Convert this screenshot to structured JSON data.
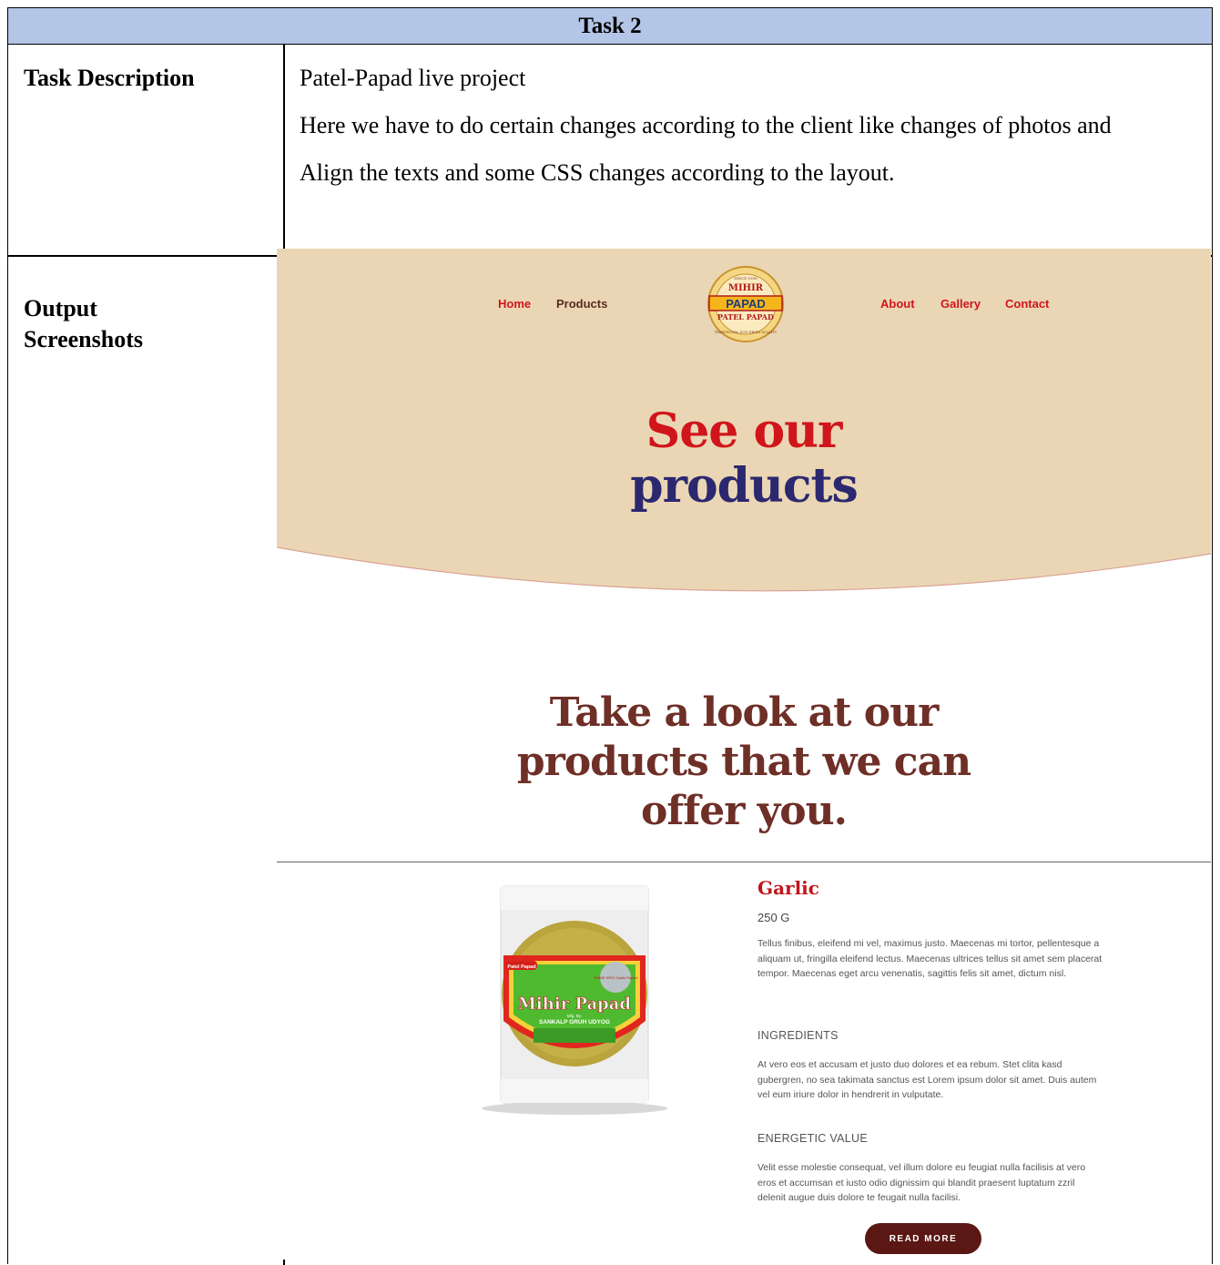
{
  "table": {
    "header": "Task 2",
    "description_label": "Task Description",
    "description_lines": [
      "Patel-Papad live project",
      "Here we have to do certain changes according to the client like changes of photos and",
      "Align the texts and some CSS changes according to the layout."
    ],
    "output_label_line1": "Output",
    "output_label_line2": "Screenshots"
  },
  "site": {
    "nav_left": [
      "Home",
      "Products"
    ],
    "nav_right": [
      "About",
      "Gallery",
      "Contact"
    ],
    "logo": {
      "top_text": "SINCE 1998",
      "brand": "MIHIR",
      "banner": "PAPAD",
      "sub": "PATEL PAPAD",
      "ring": "TRADITIONAL SUN-DRIED QUALITY"
    },
    "hero_line1": "See our",
    "hero_line2": "products",
    "tagline_lines": [
      "Take a look at our",
      "products that we can",
      "offer you."
    ],
    "product": {
      "pack_brand": "Patel Papad",
      "pack_flavor": "SHINE NPIG Garlic Papad",
      "pack_title": "Mihir Papad",
      "pack_mfg": "Mfg. By:",
      "pack_maker": "SANKALP GRUH UDYOG",
      "name": "Garlic",
      "weight": "250 G",
      "description": "Tellus finibus, eleifend mi vel, maximus justo. Maecenas mi tortor, pellentesque a aliquam ut, fringilla eleifend lectus. Maecenas ultrices tellus sit amet sem placerat tempor. Maecenas eget arcu venenatis, sagittis felis sit amet, dictum nisl.",
      "ingredients_heading": "INGREDIENTS",
      "ingredients_text": "At vero eos et accusam et justo duo dolores et ea rebum. Stet clita kasd gubergren, no sea takimata sanctus est Lorem ipsum dolor sit amet. Duis autem vel eum iriure dolor in hendrerit in vulputate.",
      "energy_heading": "ENERGETIC VALUE",
      "energy_text": "Velit esse molestie consequat, vel illum dolore eu feugiat nulla facilisis at vero eros et accumsan et iusto odio dignissim qui blandit praesent luptatum zzril delenit augue duis dolore te feugait nulla facilisi.",
      "button": "READ MORE"
    }
  },
  "colors": {
    "header_bg": "#b4c6e7",
    "hero_bg": "#ead6b4",
    "nav_active": "#d0151b",
    "nav_default": "#5a2a1e",
    "hero_red": "#d0151b",
    "hero_navy": "#2b2870",
    "tagline": "#6e2f27",
    "button_bg": "#5a1714"
  }
}
